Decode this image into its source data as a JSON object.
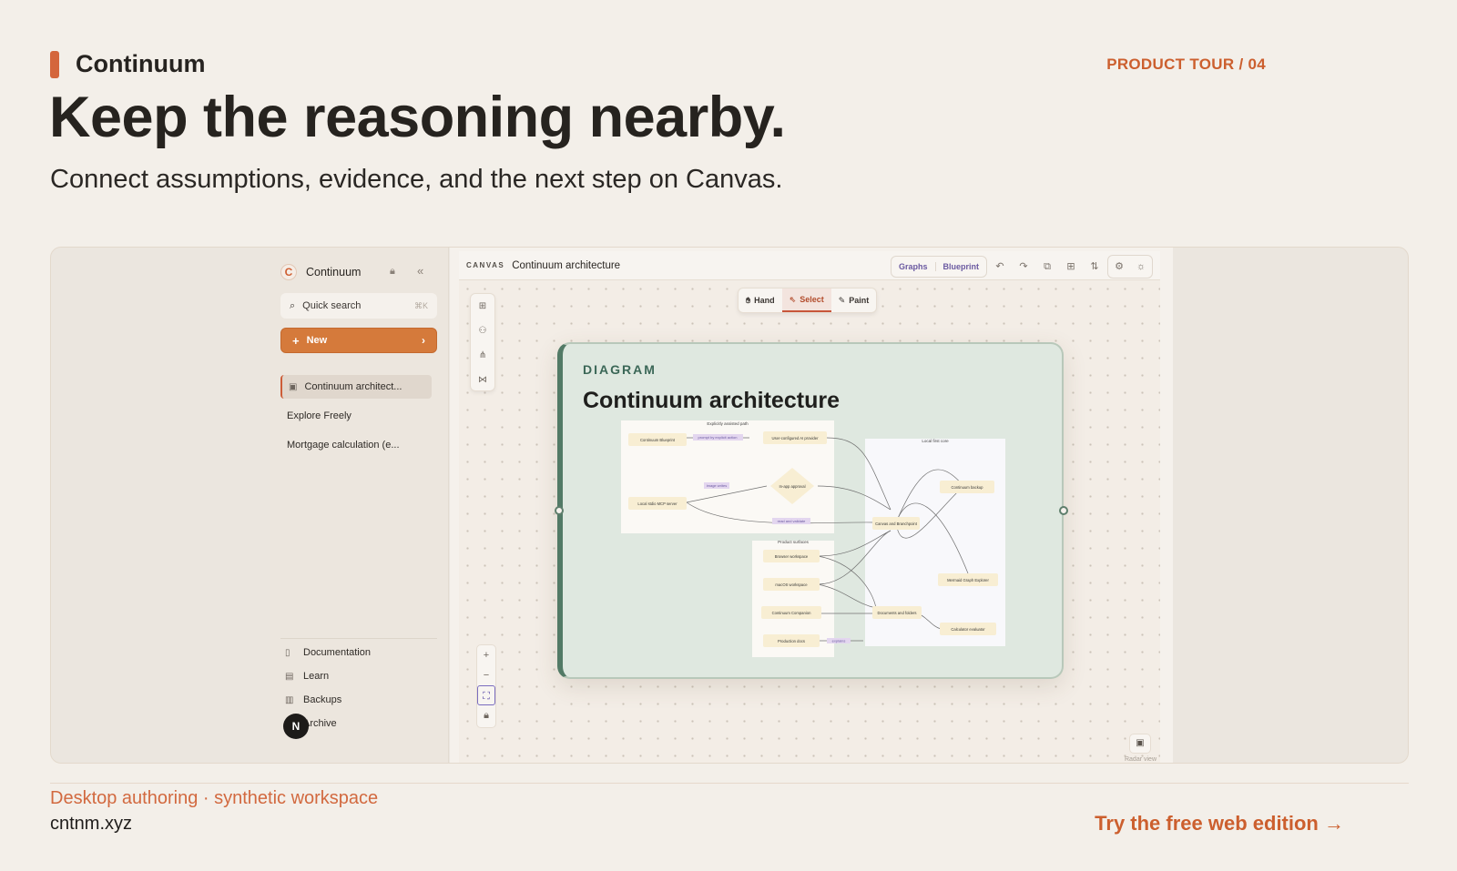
{
  "brand": {
    "name": "Continuum",
    "tag": "PRODUCT TOUR / 04"
  },
  "hero": {
    "headline": "Keep the reasoning nearby.",
    "subhead": "Connect assumptions, evidence, and the next step on Canvas."
  },
  "sidebar": {
    "app_name": "Continuum",
    "logo_letter": "C",
    "search_label": "Quick search",
    "search_shortcut": "⌘K",
    "new_label": "New",
    "items": [
      {
        "label": "Continuum architect..."
      },
      {
        "label": "Explore Freely"
      },
      {
        "label": "Mortgage calculation (e..."
      }
    ],
    "footer": [
      {
        "label": "Documentation",
        "icon": "book-icon"
      },
      {
        "label": "Learn",
        "icon": "learn-icon"
      },
      {
        "label": "Backups",
        "icon": "archive-box-icon"
      },
      {
        "label": "Archive",
        "icon": "archive-icon"
      }
    ],
    "avatar_letter": "N"
  },
  "canvas": {
    "kicker": "CANVAS",
    "title": "Continuum architecture",
    "view_tabs": [
      "Graphs",
      "Blueprint"
    ],
    "modes": [
      "Hand",
      "Select",
      "Paint"
    ],
    "active_mode": "Select",
    "minimap_caption": "Radar view"
  },
  "diagram": {
    "kicker": "DIAGRAM",
    "title": "Continuum architecture",
    "groups": [
      "Explicitly assisted path",
      "Local first core",
      "Product surfaces"
    ],
    "nodes": [
      "Continuum Blueprint",
      "User-configured AI provider",
      "In-app approval",
      "Local stdio MCP server",
      "Canvas and Branchpoint",
      "Continuum backup",
      "Browser workspace",
      "macOS workspace",
      "Continuum Companion",
      "Production docs",
      "Documents and folders",
      "Mermaid Graph Explorer",
      "Calculator evaluator"
    ],
    "edge_labels": [
      "prompt by explicit action",
      "image writes",
      "read and validate",
      "explains"
    ]
  },
  "footer": {
    "caption": "Desktop authoring · synthetic workspace",
    "site": "cntnm.xyz",
    "cta": "Try the free web edition →"
  },
  "colors": {
    "accent": "#cc5f2e",
    "diagram_green": "#527a66",
    "selected_purple": "#6b5aa1"
  }
}
